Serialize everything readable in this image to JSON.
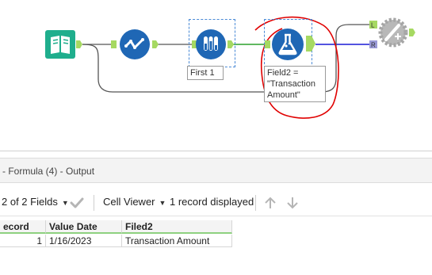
{
  "workflow": {
    "tools": [
      {
        "name": "input-data-tool",
        "icon": "book-icon",
        "color": "#1fae8d"
      },
      {
        "name": "select-tool",
        "icon": "checkmark-icon",
        "color": "#1f67b5"
      },
      {
        "name": "sample-tool",
        "icon": "test-tubes-icon",
        "color": "#1f67b5"
      },
      {
        "name": "formula-tool",
        "icon": "flask-icon",
        "color": "#1f67b5"
      },
      {
        "name": "join-tool",
        "icon": "gear-wand-icon",
        "color": "#b8b8b8"
      }
    ],
    "annotations": {
      "sample": "First 1",
      "formula_line1": "Field2 =",
      "formula_line2": "\"Transaction",
      "formula_line3": "Amount\""
    },
    "join_anchor_left": "L",
    "join_anchor_right": "R"
  },
  "results": {
    "title": "- Formula (4) - Output",
    "fields_selector": "2 of 2 Fields",
    "cell_viewer": "Cell Viewer",
    "record_status": "1 record displayed"
  },
  "grid": {
    "columns": [
      "ecord",
      "Value Date",
      "Filed2"
    ],
    "rows": [
      [
        "1",
        "1/16/2023",
        "Transaction Amount"
      ]
    ]
  },
  "colors": {
    "accent_green": "#8ed17f",
    "wire_green": "#2ca02c",
    "wire_blue": "#1a1ad6",
    "markup_red": "#e00000"
  }
}
